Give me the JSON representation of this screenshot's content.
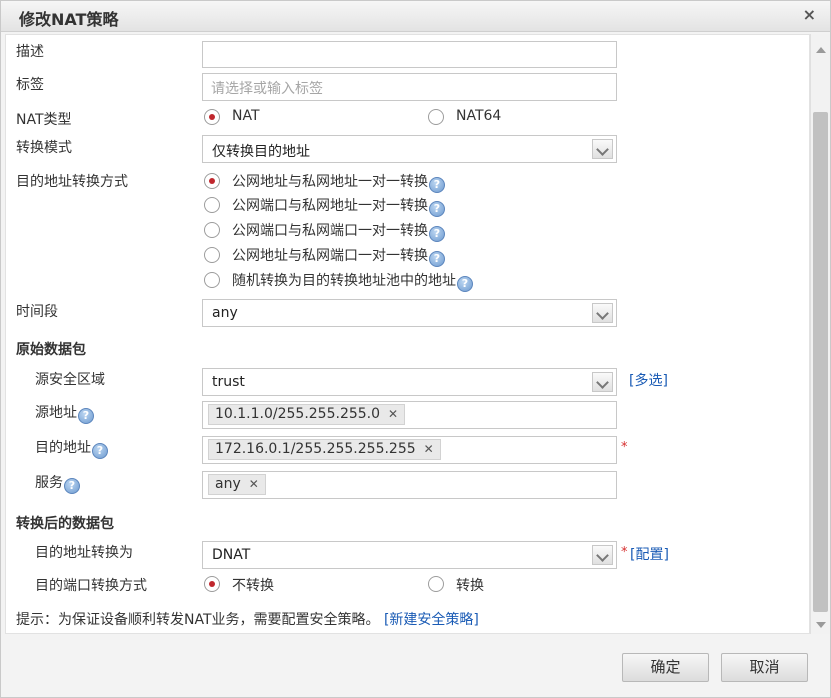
{
  "dialog": {
    "title": "修改NAT策略",
    "close_label": "×"
  },
  "form": {
    "description": {
      "label": "描述",
      "value": ""
    },
    "tags": {
      "label": "标签",
      "placeholder": "请选择或输入标签"
    },
    "nat_type": {
      "label": "NAT类型",
      "options": [
        "NAT",
        "NAT64"
      ],
      "selected": "NAT"
    },
    "convert_mode": {
      "label": "转换模式",
      "value": "仅转换目的地址"
    },
    "dst_method": {
      "label": "目的地址转换方式",
      "options": [
        "公网地址与私网地址一对一转换",
        "公网端口与私网地址一对一转换",
        "公网端口与私网端口一对一转换",
        "公网地址与私网端口一对一转换",
        "随机转换为目的转换地址池中的地址"
      ],
      "selected_index": 0
    },
    "time_range": {
      "label": "时间段",
      "value": "any"
    },
    "original_packet": {
      "section": "原始数据包",
      "src_zone": {
        "label": "源安全区域",
        "value": "trust",
        "multi_link": "[多选]"
      },
      "src_addr": {
        "label": "源地址",
        "tag": "10.1.1.0/255.255.255.0"
      },
      "dst_addr": {
        "label": "目的地址",
        "tag": "172.16.0.1/255.255.255.255",
        "required": "*"
      },
      "service": {
        "label": "服务",
        "tag": "any"
      }
    },
    "translated_packet": {
      "section": "转换后的数据包",
      "dst_translate": {
        "label": "目的地址转换为",
        "value": "DNAT",
        "required": "*",
        "config_link": "[配置]"
      },
      "port_method": {
        "label": "目的端口转换方式",
        "options": [
          "不转换",
          "转换"
        ],
        "selected": "不转换"
      }
    },
    "hint": {
      "text": "提示：为保证设备顺利转发NAT业务，需要配置安全策略。",
      "link": "[新建安全策略]"
    }
  },
  "icons": {
    "help": "question-help-icon",
    "remove": "remove-tag-icon",
    "dropdown": "chevron-down-icon"
  },
  "buttons": {
    "ok": "确定",
    "cancel": "取消"
  },
  "colors": {
    "radio_selected": "#c0272d",
    "link": "#1a5bb5",
    "required": "#d62d2d"
  }
}
